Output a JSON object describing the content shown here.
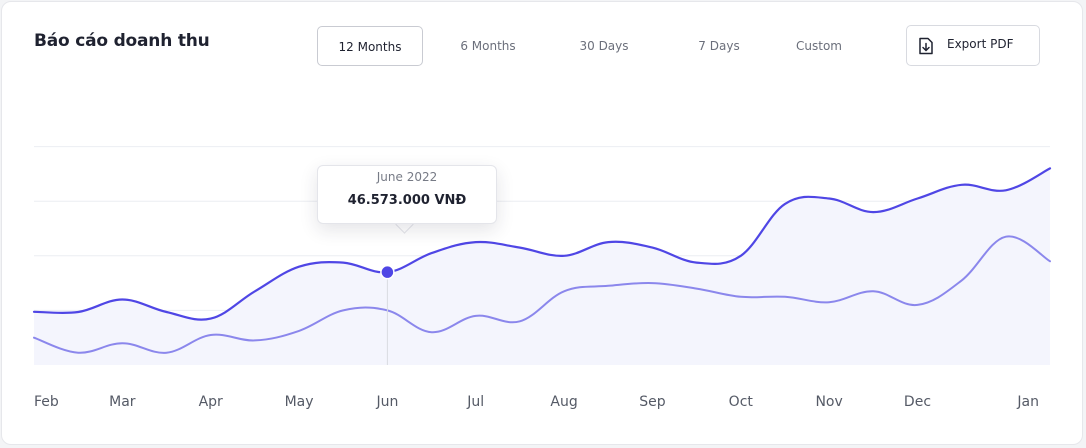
{
  "header": {
    "title": "Báo cáo doanh thu",
    "tabs": [
      "12 Months",
      "6 Months",
      "30 Days",
      "7 Days",
      "Custom"
    ],
    "active_tab": "12 Months",
    "export_label": "Export PDF"
  },
  "tooltip": {
    "label": "June 2022",
    "value": "46.573.000 VNĐ"
  },
  "colors": {
    "primary": "#4f46e5",
    "secondary": "#8b87ec",
    "fill": "#f4f5fd",
    "grid": "#eceef2"
  },
  "icons": {
    "export": "file-download-icon"
  },
  "chart_data": {
    "type": "area",
    "categories": [
      "Feb",
      "Mar",
      "Apr",
      "May",
      "Jun",
      "Jul",
      "Aug",
      "Sep",
      "Oct",
      "Nov",
      "Dec",
      "Jan"
    ],
    "x": [
      0,
      0.5,
      1,
      1.5,
      2,
      2.5,
      3,
      3.5,
      4,
      4.5,
      5,
      5.5,
      6,
      6.5,
      7,
      7.5,
      8,
      8.5,
      9,
      9.5,
      10,
      10.5,
      11,
      11.5
    ],
    "series": [
      {
        "values": [
          19.5,
          19.4,
          24.0,
          19.4,
          17.0,
          27.0,
          36.0,
          37.5,
          34.0,
          41.0,
          45.0,
          43.0,
          40.0,
          45.0,
          43.0,
          37.5,
          40.0,
          59.0,
          61.0,
          56.0,
          61.0,
          66.0,
          64.0,
          72.0
        ]
      },
      {
        "values": [
          10.0,
          4.5,
          8.0,
          4.5,
          11.0,
          9.0,
          12.5,
          20.0,
          20.0,
          12.0,
          18.0,
          16.0,
          27.0,
          29.0,
          30.0,
          28.0,
          25.0,
          25.0,
          23.0,
          27.0,
          22.0,
          31.0,
          47.0,
          38.0
        ]
      }
    ],
    "highlight": {
      "x": 4,
      "series": 0,
      "label": "June 2022"
    },
    "xlim": [
      0,
      11.5
    ],
    "ylim": [
      0,
      100
    ],
    "grid": true,
    "legend": "none"
  }
}
